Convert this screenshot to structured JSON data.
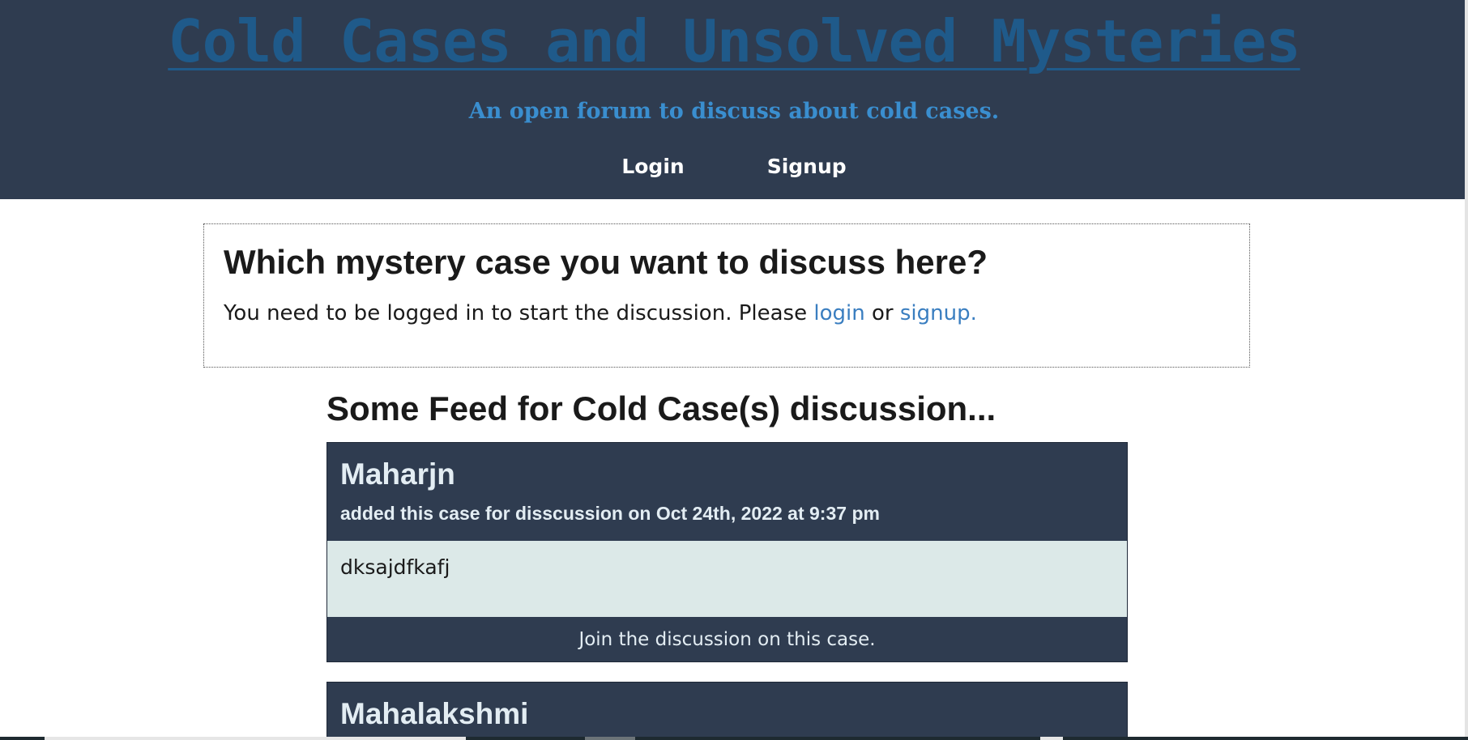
{
  "header": {
    "title": "Cold Cases and Unsolved Mysteries",
    "subtitle": "An open forum to discuss about cold cases.",
    "nav": {
      "login": "Login",
      "signup": "Signup"
    }
  },
  "prompt": {
    "heading": "Which mystery case you want to discuss here?",
    "text_before": "You need to be logged in to start the discussion. Please ",
    "login_link": "login",
    "text_middle": " or ",
    "signup_link": "signup."
  },
  "feed": {
    "heading": "Some Feed for Cold Case(s) discussion...",
    "cases": [
      {
        "author": "Maharjn",
        "meta": "added this case for disscussion on Oct 24th, 2022 at 9:37 pm",
        "body": "dksajdfkafj",
        "footer": "Join the discussion on this case."
      },
      {
        "author": "Mahalakshmi"
      }
    ]
  },
  "colors": {
    "header_bg": "#2f3c50",
    "title": "#1f5a8a",
    "subtitle": "#3a8ecf",
    "link": "#3a7ec0",
    "card_body_bg": "#dce9e8"
  }
}
